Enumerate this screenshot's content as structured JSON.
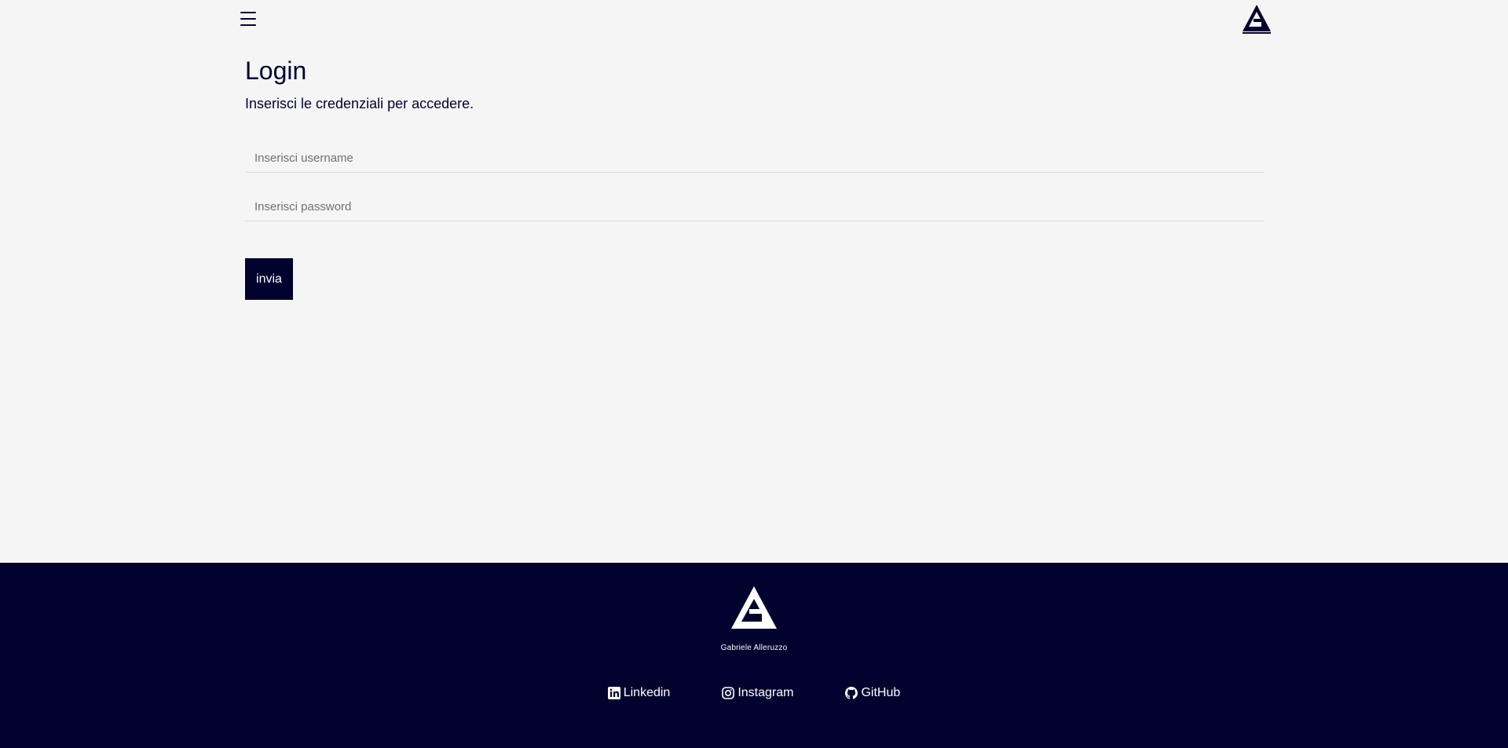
{
  "header": {
    "menu_icon": "hamburger-menu-icon",
    "logo_icon": "ga-logo-icon"
  },
  "login": {
    "title": "Login",
    "subtitle": "Inserisci le credenziali per accedere.",
    "username": {
      "value": "",
      "placeholder": "Inserisci username"
    },
    "password": {
      "value": "",
      "placeholder": "Inserisci password"
    },
    "submit_label": "invia"
  },
  "footer": {
    "brand": "Gabriele Alleruzzo",
    "links": [
      {
        "label": "Linkedin",
        "icon": "linkedin-icon"
      },
      {
        "label": "Instagram",
        "icon": "instagram-icon"
      },
      {
        "label": "GitHub",
        "icon": "github-icon"
      }
    ]
  },
  "colors": {
    "primary": "#02022f",
    "background": "#f5f5f5",
    "footer_text": "#ffffff"
  }
}
